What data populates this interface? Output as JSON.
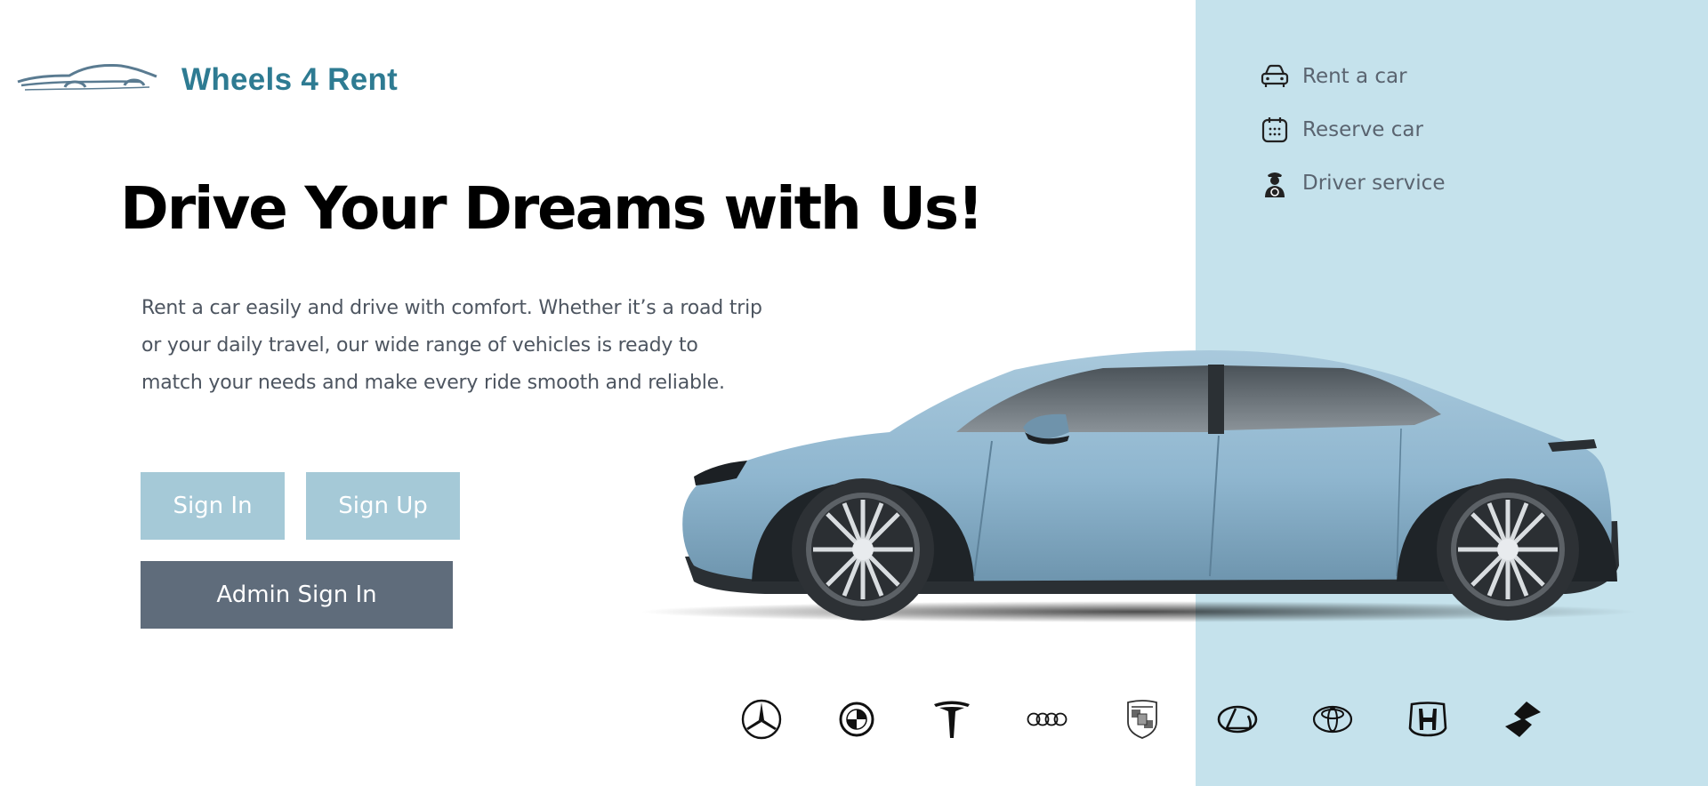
{
  "logo": {
    "text": "Wheels 4  Rent",
    "color": "#2e7b92"
  },
  "hero": {
    "title": "Drive Your Dreams with Us!",
    "description": "Rent a car easily and drive with comfort. Whether it’s a road trip or your daily travel, our wide range of vehicles is ready to match your needs and make every ride smooth and reliable."
  },
  "buttons": {
    "sign_in": "Sign In",
    "sign_up": "Sign Up",
    "admin_sign_in": "Admin Sign In"
  },
  "menu": {
    "items": [
      {
        "label": "Rent a car",
        "icon": "car-icon"
      },
      {
        "label": "Reserve car",
        "icon": "calendar-icon"
      },
      {
        "label": "Driver service",
        "icon": "driver-icon"
      }
    ]
  },
  "brands": [
    "mercedes",
    "bmw",
    "tesla",
    "audi",
    "porsche",
    "lexus",
    "toyota",
    "honda",
    "suzuki"
  ],
  "colors": {
    "panel": "#c5e2ec",
    "button_light": "#a5c9d7",
    "button_dark": "#5f6c7b",
    "car_body": "#8fb6cf"
  }
}
